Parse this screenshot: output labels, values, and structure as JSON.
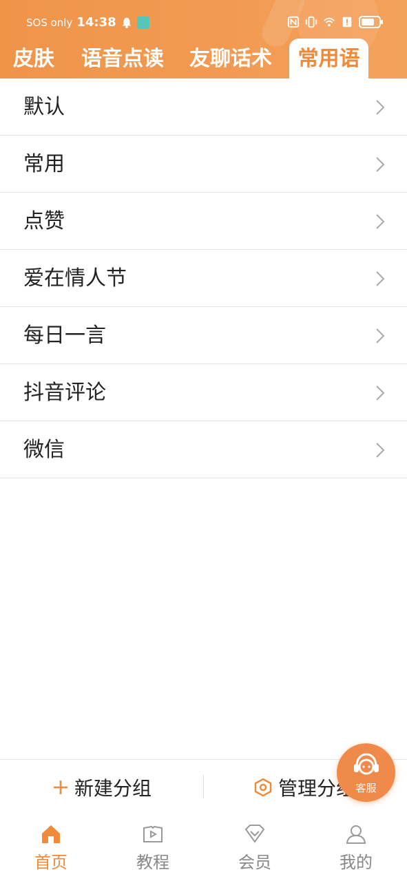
{
  "status_bar": {
    "carrier": "SOS only",
    "time": "14:38",
    "icons": [
      "bell-icon",
      "app-notification-icon",
      "nfc-icon",
      "vibrate-icon",
      "wifi-icon",
      "alert-icon",
      "battery-icon"
    ]
  },
  "tabs": [
    {
      "label": "皮肤",
      "active": false
    },
    {
      "label": "语音点读",
      "active": false
    },
    {
      "label": "友聊话术",
      "active": false
    },
    {
      "label": "常用语",
      "active": true
    }
  ],
  "groups": [
    {
      "label": "默认"
    },
    {
      "label": "常用"
    },
    {
      "label": "点赞"
    },
    {
      "label": "爱在情人节"
    },
    {
      "label": "每日一言"
    },
    {
      "label": "抖音评论"
    },
    {
      "label": "微信"
    }
  ],
  "actions": {
    "new_group": "新建分组",
    "manage_group": "管理分组"
  },
  "service_button": {
    "label": "客服"
  },
  "bottom_nav": [
    {
      "label": "首页",
      "icon": "home-icon",
      "active": true
    },
    {
      "label": "教程",
      "icon": "tutorial-icon",
      "active": false
    },
    {
      "label": "会员",
      "icon": "vip-icon",
      "active": false
    },
    {
      "label": "我的",
      "icon": "profile-icon",
      "active": false
    }
  ],
  "colors": {
    "accent": "#f08a3b",
    "header_bg": "#f29a52",
    "inactive_nav": "#888888"
  }
}
